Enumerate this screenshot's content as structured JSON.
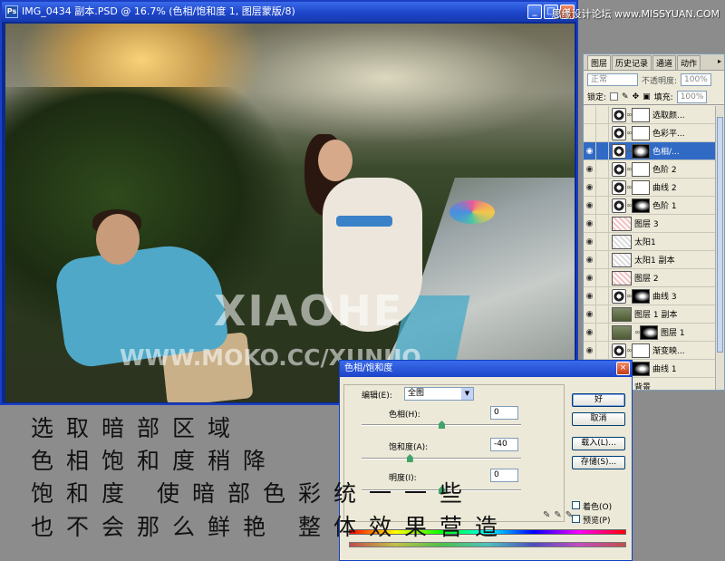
{
  "window": {
    "title": "IMG_0434 副本.PSD @ 16.7% (色相/饱和度 1, 图层蒙版/8)",
    "ps_badge": "Ps",
    "btn_min": "_",
    "btn_max": "□",
    "btn_close": "×"
  },
  "site_watermark": "思缘设计论坛 www.MISSYUAN.COM",
  "photo": {
    "watermark_main": "XIAOHE",
    "watermark_url": "WWW.MOKO.CC/XUNUO"
  },
  "layers_panel": {
    "tabs": [
      "图层",
      "历史记录",
      "通道",
      "动作"
    ],
    "menu_icon": "▸",
    "blend_mode": "正常",
    "opacity_label": "不透明度:",
    "opacity_value": "100%",
    "lock_label": "锁定:",
    "fill_label": "填充:",
    "fill_value": "100%",
    "layers": [
      {
        "name": "选取颜...",
        "visible": false,
        "type": "adjustment",
        "mask": "white"
      },
      {
        "name": "色彩平...",
        "visible": false,
        "type": "adjustment",
        "mask": "white"
      },
      {
        "name": "色相/...",
        "visible": true,
        "type": "adjustment",
        "mask": "dark",
        "active": true
      },
      {
        "name": "色阶 2",
        "visible": true,
        "type": "adjustment",
        "mask": "white"
      },
      {
        "name": "曲线 2",
        "visible": true,
        "type": "adjustment",
        "mask": "white"
      },
      {
        "name": "色阶 1",
        "visible": true,
        "type": "adjustment",
        "mask": "black"
      },
      {
        "name": "图层 3",
        "visible": true,
        "type": "pixel-red"
      },
      {
        "name": "太阳1",
        "visible": true,
        "type": "pixel"
      },
      {
        "name": "太阳1 副本",
        "visible": true,
        "type": "pixel"
      },
      {
        "name": "图层 2",
        "visible": true,
        "type": "pixel-red"
      },
      {
        "name": "曲线 3",
        "visible": true,
        "type": "adjustment",
        "mask": "black"
      },
      {
        "name": "图层 1 副本",
        "visible": true,
        "type": "photo"
      },
      {
        "name": "图层 1",
        "visible": true,
        "type": "photo",
        "mask": "black"
      },
      {
        "name": "渐变映...",
        "visible": true,
        "type": "adjustment",
        "mask": "white"
      },
      {
        "name": "曲线 1",
        "visible": true,
        "type": "adjustment",
        "mask": "black"
      },
      {
        "name": "背景",
        "visible": true,
        "type": "photo"
      }
    ]
  },
  "dialog": {
    "title": "色相/饱和度",
    "close": "×",
    "edit_label": "编辑(E):",
    "edit_value": "全图",
    "hue_label": "色相(H):",
    "hue_value": "0",
    "hue_level": 0.5,
    "sat_label": "饱和度(A):",
    "sat_value": "-40",
    "sat_level": 0.3,
    "light_label": "明度(I):",
    "light_value": "0",
    "light_level": 0.5,
    "ok": "好",
    "cancel": "取消",
    "load": "载入(L)...",
    "save": "存储(S)...",
    "colorize": "着色(O)",
    "preview": "预览(P)",
    "eyedroppers": "✎✎✎"
  },
  "caption": {
    "line1": "选取暗部区域",
    "line2": "色相饱和度稍降",
    "line3": "饱和度 使暗部色彩统一一些",
    "line4": "也不会那么鲜艳  整体效果营造"
  }
}
